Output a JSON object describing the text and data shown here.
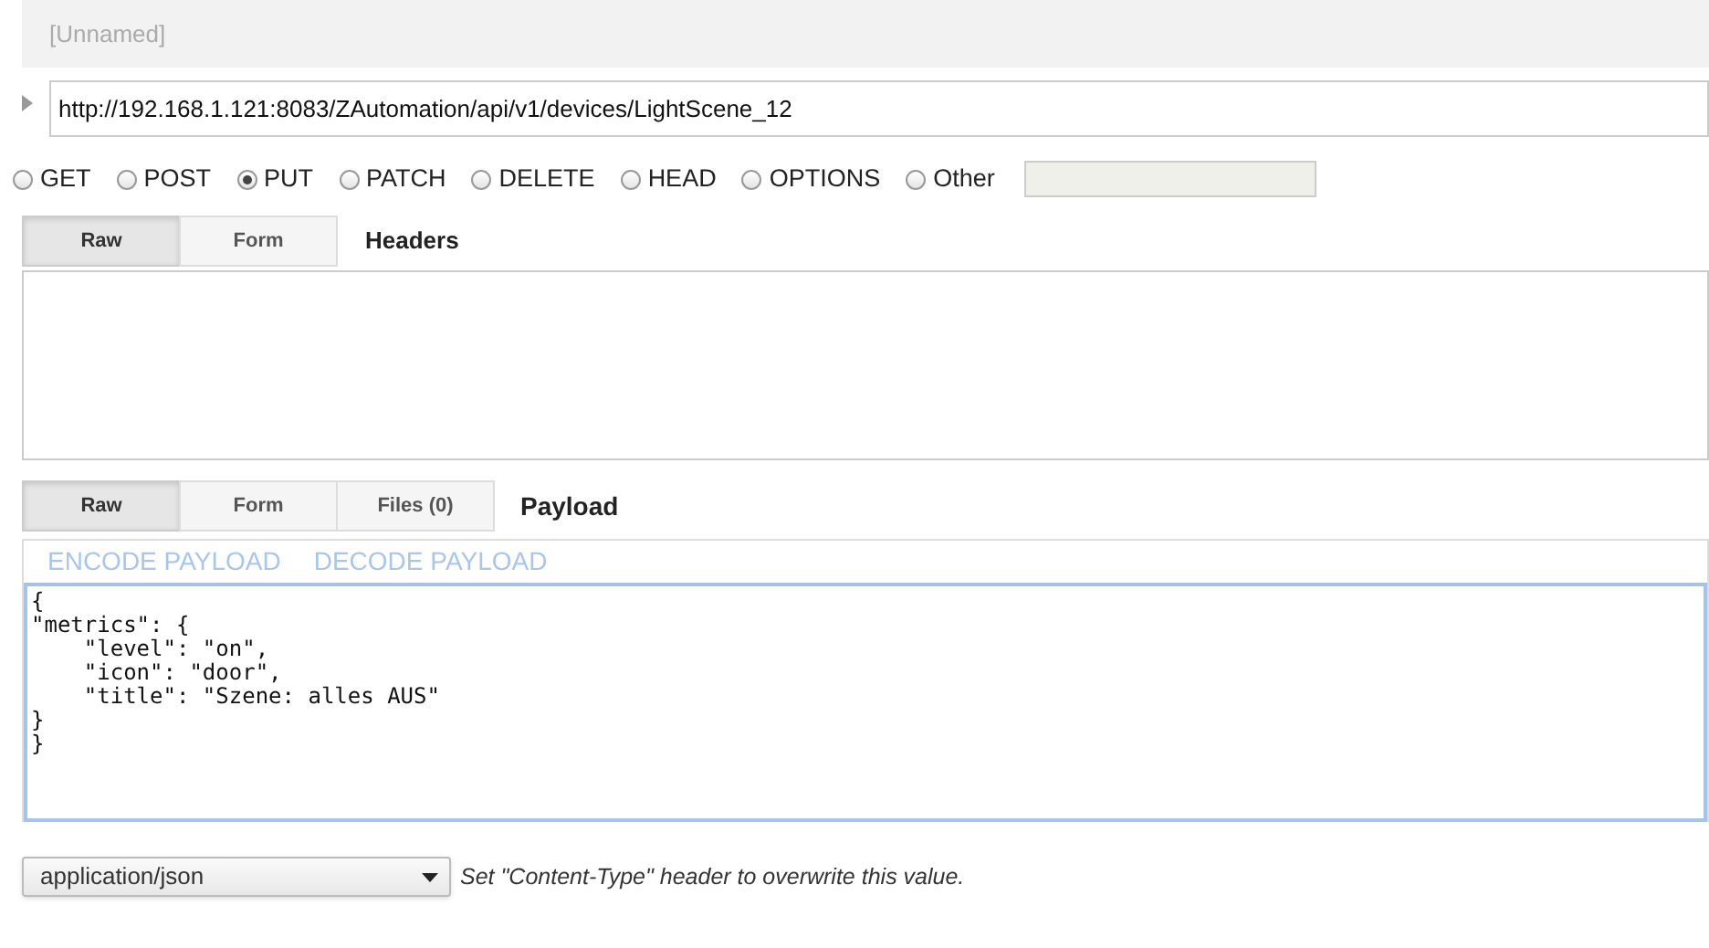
{
  "request_name": "[Unnamed]",
  "url": "http://192.168.1.121:8083/ZAutomation/api/v1/devices/LightScene_12",
  "methods": [
    {
      "label": "GET",
      "selected": false
    },
    {
      "label": "POST",
      "selected": false
    },
    {
      "label": "PUT",
      "selected": true
    },
    {
      "label": "PATCH",
      "selected": false
    },
    {
      "label": "DELETE",
      "selected": false
    },
    {
      "label": "HEAD",
      "selected": false
    },
    {
      "label": "OPTIONS",
      "selected": false
    },
    {
      "label": "Other",
      "selected": false
    }
  ],
  "headers": {
    "tabs": [
      {
        "label": "Raw",
        "selected": true
      },
      {
        "label": "Form",
        "selected": false
      }
    ],
    "title": "Headers"
  },
  "payload": {
    "tabs": [
      {
        "label": "Raw",
        "selected": true
      },
      {
        "label": "Form",
        "selected": false
      },
      {
        "label": "Files (0)",
        "selected": false
      }
    ],
    "title": "Payload",
    "actions": [
      "ENCODE PAYLOAD",
      "DECODE PAYLOAD"
    ],
    "body": "{\n\"metrics\": {\n    \"level\": \"on\",\n    \"icon\": \"door\",\n    \"title\": \"Szene: alles AUS\"\n}\n}"
  },
  "content_type": {
    "value": "application/json",
    "hint": "Set \"Content-Type\" header to overwrite this value."
  }
}
